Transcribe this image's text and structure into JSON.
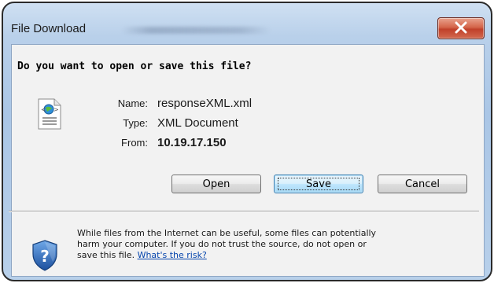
{
  "window": {
    "title": "File Download",
    "close_icon": "close-icon"
  },
  "dialog": {
    "question": "Do you want to open or save this file?",
    "file": {
      "icon": "xml-file-icon",
      "name_label": "Name:",
      "name_value": "responseXML.xml",
      "type_label": "Type:",
      "type_value": "XML Document",
      "from_label": "From:",
      "from_value": "10.19.17.150"
    },
    "buttons": {
      "open": "Open",
      "save": "Save",
      "cancel": "Cancel"
    },
    "warning": {
      "icon": "security-shield-icon",
      "line1": "While files from the Internet can be useful, some files can potentially",
      "line2": "harm your computer. If you do not trust the source, do not open or",
      "line3_prefix": "save this file. ",
      "link": "What's the risk?"
    }
  },
  "colors": {
    "accent": "#3c7fb1",
    "link": "#0645ad",
    "close_red": "#c0412a"
  }
}
